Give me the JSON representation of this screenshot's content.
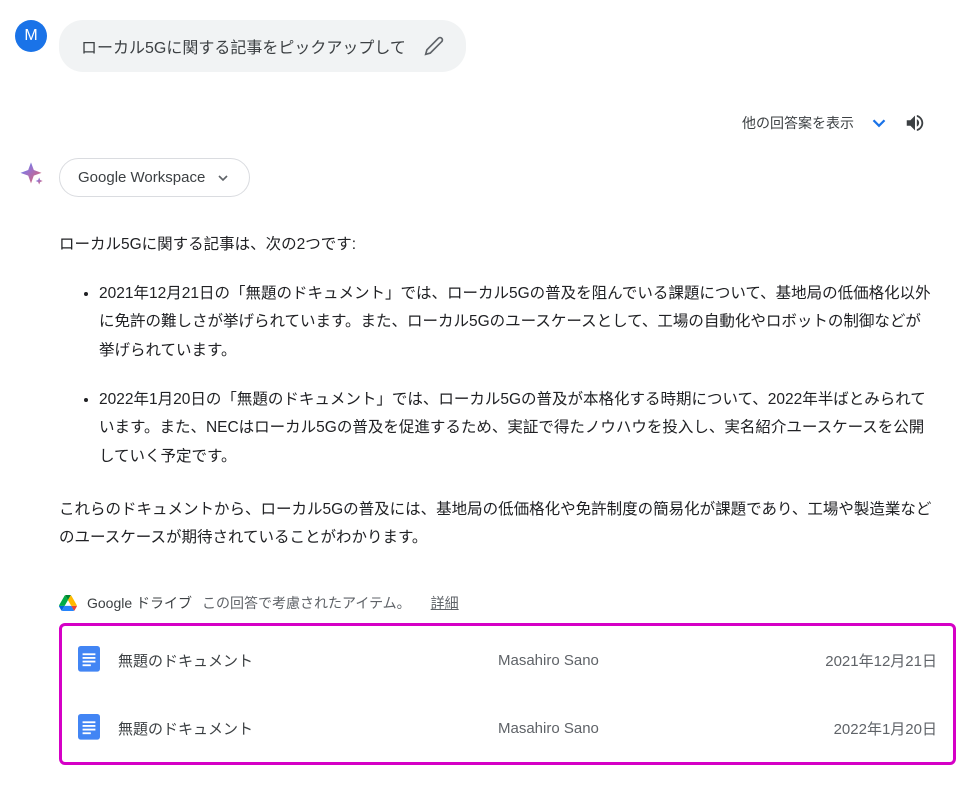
{
  "user": {
    "avatar_letter": "M",
    "prompt_text": "ローカル5Gに関する記事をピックアップして"
  },
  "actions": {
    "show_drafts_label": "他の回答案を表示"
  },
  "workspace_chip": {
    "label": "Google Workspace"
  },
  "response": {
    "intro": "ローカル5Gに関する記事は、次の2つです:",
    "items": [
      "2021年12月21日の「無題のドキュメント」では、ローカル5Gの普及を阻んでいる課題について、基地局の低価格化以外に免許の難しさが挙げられています。また、ローカル5Gのユースケースとして、工場の自動化やロボットの制御などが挙げられています。",
      "2022年1月20日の「無題のドキュメント」では、ローカル5Gの普及が本格化する時期について、2022年半ばとみられています。また、NECはローカル5Gの普及を促進するため、実証で得たノウハウを投入し、実名紹介ユースケースを公開していく予定です。"
    ],
    "conclusion": "これらのドキュメントから、ローカル5Gの普及には、基地局の低価格化や免許制度の簡易化が課題であり、工場や製造業などのユースケースが期待されていることがわかります。"
  },
  "drive_section": {
    "service_name": "Google ドライブ",
    "considered_text": "この回答で考慮されたアイテム。",
    "detail_link": "詳細",
    "documents": [
      {
        "title": "無題のドキュメント",
        "owner": "Masahiro Sano",
        "date": "2021年12月21日"
      },
      {
        "title": "無題のドキュメント",
        "owner": "Masahiro Sano",
        "date": "2022年1月20日"
      }
    ]
  }
}
